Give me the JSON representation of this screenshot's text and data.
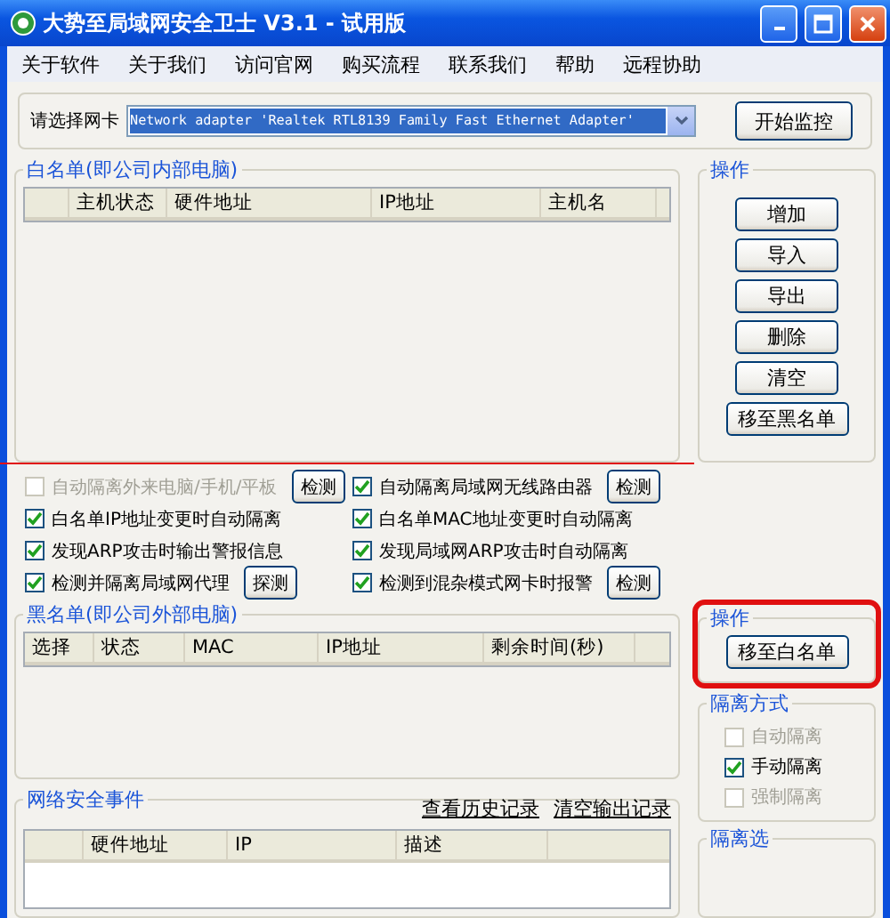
{
  "window": {
    "title": "大势至局域网安全卫士 V3.1 - 试用版"
  },
  "menu": [
    "关于软件",
    "关于我们",
    "访问官网",
    "购买流程",
    "联系我们",
    "帮助",
    "远程协助"
  ],
  "adapter": {
    "label": "请选择网卡",
    "value": "Network adapter 'Realtek RTL8139 Family Fast Ethernet Adapter'",
    "button": "开始监控"
  },
  "whitelist": {
    "title": "白名单(即公司内部电脑)",
    "underlined": true,
    "columns": [
      "主机状态",
      "硬件地址",
      "IP地址",
      "主机名"
    ]
  },
  "whitelist_actions": {
    "title": "操作",
    "buttons": [
      "增加",
      "导入",
      "导出",
      "删除",
      "清空",
      "移至黑名单"
    ]
  },
  "options": [
    {
      "label": "自动隔离外来电脑/手机/平板",
      "checked": false,
      "disabled": true,
      "button": "检测"
    },
    {
      "label": "自动隔离局域网无线路由器",
      "checked": true,
      "disabled": false,
      "button": "检测"
    },
    {
      "label": "白名单IP地址变更时自动隔离",
      "checked": true,
      "disabled": false
    },
    {
      "label": "白名单MAC地址变更时自动隔离",
      "checked": true,
      "disabled": false
    },
    {
      "label": "发现ARP攻击时输出警报信息",
      "checked": true,
      "disabled": false
    },
    {
      "label": "发现局域网ARP攻击时自动隔离",
      "checked": true,
      "disabled": false
    },
    {
      "label": "检测并隔离局域网代理",
      "checked": true,
      "disabled": false,
      "button": "探测"
    },
    {
      "label": "检测到混杂模式网卡时报警",
      "checked": true,
      "disabled": false,
      "button": "检测"
    }
  ],
  "blacklist": {
    "title": "黑名单(即公司外部电脑)",
    "columns": [
      "选择",
      "状态",
      "MAC",
      "IP地址",
      "剩余时间(秒)"
    ]
  },
  "blacklist_actions": {
    "title": "操作",
    "highlighted": true,
    "buttons": [
      "移至白名单"
    ]
  },
  "isolation_mode": {
    "title": "隔离方式",
    "options": [
      {
        "label": "自动隔离",
        "checked": false,
        "disabled": true
      },
      {
        "label": "手动隔离",
        "checked": true,
        "disabled": false
      },
      {
        "label": "强制隔离",
        "checked": false,
        "disabled": true
      }
    ]
  },
  "events": {
    "title": "网络安全事件",
    "links": [
      "查看历史记录",
      "清空输出记录"
    ],
    "columns": [
      "硬件地址",
      "IP",
      "描述"
    ]
  },
  "isolation_options": {
    "title": "隔离选"
  }
}
